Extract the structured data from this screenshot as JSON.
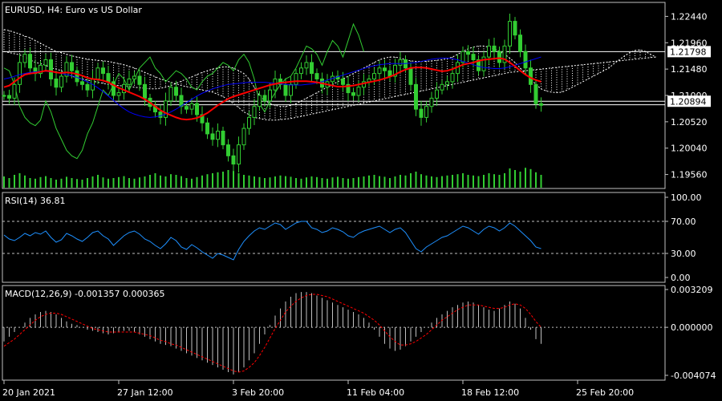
{
  "chart_data": [
    {
      "type": "candlestick",
      "title": "EURUSD, H4:  Euro vs US Dollar",
      "ylim": [
        1.1932,
        1.2268
      ],
      "y_ticks": [
        "1.22440",
        "1.21960",
        "1.21480",
        "1.21000",
        "1.20520",
        "1.20040",
        "1.19560"
      ],
      "price_labels": [
        {
          "value": 1.21798,
          "text": "1.21798"
        },
        {
          "value": 1.20894,
          "text": "1.20894"
        }
      ],
      "hlines": [
        1.21798,
        1.20894,
        1.2083
      ],
      "grid": false,
      "colors": {
        "candle": "#32cd32",
        "ma_fast": "#ff0000",
        "ma_slow": "#0000ff",
        "lagging": "#32cd32",
        "cloud": "#ffffff",
        "volume": "#32cd32"
      },
      "close": [
        1.21,
        1.2095,
        1.212,
        1.216,
        1.2175,
        1.215,
        1.214,
        1.2155,
        1.2165,
        1.213,
        1.2115,
        1.2135,
        1.216,
        1.2145,
        1.2125,
        1.212,
        1.211,
        1.213,
        1.215,
        1.214,
        1.2125,
        1.21,
        1.2105,
        1.212,
        1.213,
        1.2135,
        1.212,
        1.2095,
        1.208,
        1.207,
        1.206,
        1.209,
        1.2115,
        1.21,
        1.208,
        1.2075,
        1.2085,
        1.2065,
        1.205,
        1.203,
        1.202,
        1.2035,
        1.201,
        1.199,
        1.1975,
        1.201,
        1.204,
        1.206,
        1.208,
        1.21,
        1.209,
        1.211,
        1.213,
        1.212,
        1.21,
        1.212,
        1.214,
        1.215,
        1.216,
        1.214,
        1.213,
        1.2115,
        1.2125,
        1.2135,
        1.213,
        1.212,
        1.2105,
        1.21,
        1.2115,
        1.2125,
        1.213,
        1.214,
        1.215,
        1.2145,
        1.2135,
        1.2155,
        1.2165,
        1.215,
        1.212,
        1.2075,
        1.206,
        1.208,
        1.2095,
        1.211,
        1.212,
        1.2125,
        1.214,
        1.216,
        1.218,
        1.2175,
        1.2165,
        1.2145,
        1.217,
        1.219,
        1.218,
        1.216,
        1.219,
        1.2235,
        1.221,
        1.218,
        1.215,
        1.212,
        1.2085,
        1.2082
      ],
      "ma_fast": [
        1.2115,
        1.2118,
        1.2125,
        1.2132,
        1.2138,
        1.214,
        1.2141,
        1.2143,
        1.2145,
        1.2144,
        1.2142,
        1.2141,
        1.2142,
        1.2141,
        1.2139,
        1.2136,
        1.2132,
        1.213,
        1.2129,
        1.2127,
        1.2124,
        1.2119,
        1.2114,
        1.211,
        1.2106,
        1.2102,
        1.2098,
        1.2093,
        1.2087,
        1.208,
        1.2073,
        1.2068,
        1.2064,
        1.206,
        1.2057,
        1.2056,
        1.2057,
        1.2059,
        1.2063,
        1.2068,
        1.2075,
        1.2082,
        1.2088,
        1.2094,
        1.2098,
        1.2101,
        1.2104,
        1.2107,
        1.211,
        1.2113,
        1.2116,
        1.2119,
        1.2121,
        1.2123,
        1.2124,
        1.2125,
        1.2126,
        1.2126,
        1.2126,
        1.2125,
        1.2124,
        1.2122,
        1.212,
        1.2118,
        1.2116,
        1.2116,
        1.2117,
        1.2118,
        1.212,
        1.2122,
        1.2124,
        1.2126,
        1.2128,
        1.2131,
        1.2134,
        1.2138,
        1.2143,
        1.2147,
        1.215,
        1.2151,
        1.2151,
        1.215,
        1.2148,
        1.2146,
        1.2144,
        1.2145,
        1.2148,
        1.2152,
        1.2156,
        1.2158,
        1.216,
        1.2163,
        1.2165,
        1.2166,
        1.2167,
        1.2168,
        1.2166,
        1.216,
        1.2153,
        1.2145,
        1.2138,
        1.2132,
        1.2128,
        1.2125
      ],
      "ma_slow": [
        1.213,
        1.2132,
        1.2135,
        1.2138,
        1.214,
        1.2142,
        1.2143,
        1.2144,
        1.2144,
        1.2143,
        1.2142,
        1.214,
        1.2138,
        1.2136,
        1.2133,
        1.2129,
        1.2125,
        1.212,
        1.2114,
        1.2107,
        1.2099,
        1.2091,
        1.2083,
        1.2076,
        1.207,
        1.2066,
        1.2063,
        1.2061,
        1.206,
        1.2061,
        1.2063,
        1.2066,
        1.207,
        1.2075,
        1.2081,
        1.2087,
        1.2093,
        1.2099,
        1.2104,
        1.2108,
        1.2112,
        1.2115,
        1.2118,
        1.212,
        1.2121,
        1.2122,
        1.2123,
        1.2124,
        1.2124,
        1.2124,
        1.2124,
        1.2123,
        1.2122,
        1.2121,
        1.212,
        1.2119,
        1.2119,
        1.2119,
        1.212,
        1.2121,
        1.2123,
        1.2125,
        1.2128,
        1.2131,
        1.2134,
        1.2137,
        1.214,
        1.2143,
        1.2146,
        1.2149,
        1.2152,
        1.2154,
        1.2156,
        1.2157,
        1.2158,
        1.2158,
        1.2158,
        1.2158,
        1.2159,
        1.216,
        1.2162,
        1.2164,
        1.2166,
        1.2167,
        1.2168,
        1.2168,
        1.2167,
        1.2165,
        1.2162,
        1.2159,
        1.2156,
        1.2153,
        1.2151,
        1.215,
        1.2149,
        1.2149,
        1.215,
        1.2152,
        1.2155,
        1.2158,
        1.2161,
        1.2164,
        1.2167,
        1.217
      ],
      "lagging": [
        1.215,
        1.2145,
        1.212,
        1.208,
        1.206,
        1.205,
        1.2045,
        1.2055,
        1.209,
        1.207,
        1.204,
        1.202,
        1.2,
        1.199,
        1.1985,
        1.2,
        1.203,
        1.205,
        1.208,
        1.211,
        1.21,
        1.212,
        1.214,
        1.213,
        1.211,
        1.213,
        1.215,
        1.216,
        1.217,
        1.215,
        1.214,
        1.2125,
        1.2135,
        1.2145,
        1.214,
        1.213,
        1.2115,
        1.211,
        1.2125,
        1.2135,
        1.214,
        1.215,
        1.216,
        1.2155,
        1.2145,
        1.2165,
        1.2175,
        1.216,
        1.213,
        1.2085,
        1.207,
        1.209,
        1.2105,
        1.212,
        1.213,
        1.2135,
        1.215,
        1.217,
        1.219,
        1.2185,
        1.2175,
        1.2155,
        1.218,
        1.22,
        1.219,
        1.217,
        1.22,
        1.223,
        1.221,
        1.218
      ],
      "cloud_a": [
        1.218,
        1.2178,
        1.2176,
        1.2174,
        1.217,
        1.2165,
        1.216,
        1.2158,
        1.2155,
        1.215,
        1.2148,
        1.2145,
        1.214,
        1.2135,
        1.2132,
        1.213,
        1.2128,
        1.2126,
        1.2124,
        1.2122,
        1.212,
        1.2119,
        1.2118,
        1.2117,
        1.2116,
        1.2115,
        1.2114,
        1.2113,
        1.2112,
        1.2112,
        1.2113,
        1.2115,
        1.2118,
        1.2122,
        1.2126,
        1.213,
        1.2134,
        1.2138,
        1.2142,
        1.2145,
        1.2148,
        1.215,
        1.2152,
        1.2152,
        1.215,
        1.2145,
        1.214,
        1.213,
        1.2115,
        1.21,
        1.209,
        1.2085,
        1.2082,
        1.208,
        1.208,
        1.2082,
        1.2085,
        1.209,
        1.2095,
        1.21,
        1.2105,
        1.211,
        1.2115,
        1.212,
        1.2125,
        1.213,
        1.2135,
        1.214,
        1.2145,
        1.215,
        1.2155,
        1.216,
        1.2165,
        1.2168,
        1.217,
        1.217,
        1.2168,
        1.2165,
        1.2163,
        1.2162,
        1.2162,
        1.2162,
        1.2163,
        1.2164,
        1.2165,
        1.2167,
        1.217,
        1.2175,
        1.218,
        1.2185,
        1.2188,
        1.219,
        1.219,
        1.2188,
        1.2185,
        1.218,
        1.2175,
        1.2168,
        1.216,
        1.215,
        1.214,
        1.213,
        1.212,
        1.2112,
        1.2108,
        1.2106,
        1.2105,
        1.2106,
        1.211,
        1.2115,
        1.212,
        1.2125,
        1.213,
        1.2135,
        1.214,
        1.2145,
        1.215,
        1.2158,
        1.2165,
        1.2172,
        1.2178,
        1.2182,
        1.2183,
        1.218,
        1.2175,
        1.217
      ],
      "cloud_b": [
        1.222,
        1.2218,
        1.2215,
        1.2212,
        1.2208,
        1.2205,
        1.22,
        1.2195,
        1.219,
        1.2185,
        1.218,
        1.2178,
        1.2175,
        1.2172,
        1.217,
        1.2168,
        1.2166,
        1.2165,
        1.2164,
        1.2163,
        1.2162,
        1.216,
        1.2158,
        1.2156,
        1.2153,
        1.215,
        1.2146,
        1.2142,
        1.2138,
        1.2134,
        1.213,
        1.2127,
        1.2124,
        1.2121,
        1.2118,
        1.2116,
        1.2114,
        1.2112,
        1.211,
        1.2108,
        1.2106,
        1.2102,
        1.2098,
        1.2092,
        1.2085,
        1.2078,
        1.207,
        1.2065,
        1.206,
        1.2058,
        1.2056,
        1.2055,
        1.2055,
        1.2056,
        1.2057,
        1.2058,
        1.206,
        1.2062,
        1.2064,
        1.2066,
        1.2068,
        1.207,
        1.2072,
        1.2074,
        1.2076,
        1.2078,
        1.208,
        1.2082,
        1.2084,
        1.2086,
        1.2088,
        1.209,
        1.2092,
        1.2094,
        1.2096,
        1.2098,
        1.21,
        1.2102,
        1.2104,
        1.2106,
        1.2108,
        1.211,
        1.2112,
        1.2114,
        1.2116,
        1.2118,
        1.212,
        1.2122,
        1.2124,
        1.2126,
        1.2128,
        1.213,
        1.2132,
        1.2134,
        1.2136,
        1.2138,
        1.214,
        1.2142,
        1.2143,
        1.2144,
        1.2145,
        1.2146,
        1.2147,
        1.2148,
        1.2149,
        1.215,
        1.2151,
        1.2152,
        1.2153,
        1.2154,
        1.2155,
        1.2156,
        1.2157,
        1.2158,
        1.2159,
        1.216,
        1.2161,
        1.2162,
        1.2163,
        1.2164,
        1.2165,
        1.2166,
        1.2167,
        1.2168,
        1.2169,
        1.217
      ],
      "volume": [
        0.35,
        0.3,
        0.4,
        0.45,
        0.38,
        0.3,
        0.28,
        0.33,
        0.36,
        0.3,
        0.25,
        0.28,
        0.34,
        0.3,
        0.27,
        0.25,
        0.3,
        0.35,
        0.4,
        0.32,
        0.28,
        0.3,
        0.33,
        0.36,
        0.3,
        0.28,
        0.32,
        0.35,
        0.4,
        0.45,
        0.38,
        0.35,
        0.42,
        0.4,
        0.36,
        0.3,
        0.28,
        0.33,
        0.38,
        0.42,
        0.45,
        0.48,
        0.5,
        0.55,
        0.52,
        0.45,
        0.4,
        0.38,
        0.35,
        0.33,
        0.3,
        0.32,
        0.35,
        0.38,
        0.36,
        0.34,
        0.3,
        0.28,
        0.32,
        0.35,
        0.33,
        0.3,
        0.28,
        0.32,
        0.34,
        0.3,
        0.28,
        0.3,
        0.33,
        0.35,
        0.38,
        0.4,
        0.36,
        0.34,
        0.3,
        0.35,
        0.4,
        0.38,
        0.45,
        0.5,
        0.42,
        0.38,
        0.35,
        0.33,
        0.36,
        0.38,
        0.4,
        0.42,
        0.45,
        0.4,
        0.38,
        0.36,
        0.4,
        0.45,
        0.42,
        0.4,
        0.45,
        0.6,
        0.55,
        0.5,
        0.62,
        0.58,
        0.48,
        0.4
      ]
    },
    {
      "type": "line",
      "title": "RSI(14) 36.81",
      "ylim": [
        0,
        100
      ],
      "y_ticks": [
        "100.00",
        "70.00",
        "30.00",
        "0.00"
      ],
      "levels": [
        70,
        30
      ],
      "colors": {
        "line": "#1e90ff",
        "level": "#c0c0c0"
      },
      "values": [
        53,
        48,
        46,
        50,
        55,
        52,
        56,
        54,
        58,
        50,
        44,
        47,
        55,
        52,
        48,
        45,
        50,
        56,
        58,
        52,
        48,
        40,
        46,
        52,
        56,
        58,
        54,
        48,
        45,
        40,
        36,
        42,
        50,
        46,
        38,
        35,
        41,
        37,
        32,
        28,
        24,
        30,
        28,
        25,
        22,
        35,
        45,
        52,
        58,
        62,
        60,
        64,
        68,
        66,
        60,
        64,
        68,
        70,
        70,
        62,
        60,
        56,
        58,
        62,
        60,
        57,
        52,
        50,
        55,
        58,
        60,
        62,
        64,
        60,
        56,
        60,
        62,
        56,
        46,
        36,
        32,
        38,
        42,
        46,
        50,
        52,
        56,
        60,
        64,
        62,
        58,
        54,
        60,
        64,
        62,
        58,
        62,
        68,
        64,
        58,
        52,
        46,
        38,
        36
      ]
    },
    {
      "type": "bar",
      "title": "MACD(12,26,9) -0.001357 0.000365",
      "ylim": [
        -0.004074,
        0.003209
      ],
      "y_ticks": [
        "0.003209",
        "0.000000",
        "-0.004074"
      ],
      "colors": {
        "bar": "#c0c0c0",
        "signal": "#ff0000",
        "zero": "#c0c0c0"
      },
      "values": [
        -0.0012,
        -0.0008,
        -0.0004,
        0.0,
        0.0004,
        0.0008,
        0.0011,
        0.0013,
        0.0014,
        0.0013,
        0.0011,
        0.0008,
        0.0005,
        0.0003,
        0.0002,
        0.0,
        -0.0002,
        -0.0003,
        -0.0004,
        -0.0005,
        -0.0006,
        -0.0005,
        -0.0004,
        -0.0003,
        -0.0003,
        -0.0004,
        -0.0006,
        -0.0008,
        -0.001,
        -0.0012,
        -0.0014,
        -0.0015,
        -0.0016,
        -0.0018,
        -0.002,
        -0.0022,
        -0.0024,
        -0.0026,
        -0.0028,
        -0.003,
        -0.0032,
        -0.0034,
        -0.0036,
        -0.0038,
        -0.004,
        -0.0038,
        -0.0034,
        -0.0028,
        -0.0022,
        -0.0014,
        -0.0006,
        0.0002,
        0.001,
        0.0016,
        0.0022,
        0.0026,
        0.0029,
        0.003,
        0.003,
        0.0029,
        0.0027,
        0.0025,
        0.0023,
        0.0021,
        0.0019,
        0.0017,
        0.0015,
        0.0013,
        0.0011,
        0.0008,
        0.0004,
        -0.0002,
        -0.0008,
        -0.0014,
        -0.0018,
        -0.002,
        -0.0019,
        -0.0016,
        -0.0012,
        -0.0008,
        -0.0004,
        0.0,
        0.0004,
        0.0008,
        0.0011,
        0.0014,
        0.0017,
        0.0019,
        0.0021,
        0.0022,
        0.0021,
        0.0019,
        0.0017,
        0.0015,
        0.0014,
        0.0016,
        0.0019,
        0.0022,
        0.002,
        0.0016,
        0.0008,
        -0.0002,
        -0.001,
        -0.0014
      ],
      "signal": [
        -0.0016,
        -0.0013,
        -0.001,
        -0.0006,
        -0.0002,
        0.0002,
        0.0006,
        0.0009,
        0.0011,
        0.0012,
        0.0012,
        0.0011,
        0.0009,
        0.0007,
        0.0005,
        0.0003,
        0.0001,
        -0.0001,
        -0.0002,
        -0.0003,
        -0.0004,
        -0.0004,
        -0.0004,
        -0.0004,
        -0.0004,
        -0.0004,
        -0.0005,
        -0.0006,
        -0.0007,
        -0.0009,
        -0.0011,
        -0.0012,
        -0.0014,
        -0.0015,
        -0.0017,
        -0.0019,
        -0.0021,
        -0.0023,
        -0.0025,
        -0.0027,
        -0.0029,
        -0.0031,
        -0.0033,
        -0.0035,
        -0.0037,
        -0.0038,
        -0.0037,
        -0.0034,
        -0.003,
        -0.0024,
        -0.0017,
        -0.0009,
        -0.0001,
        0.0006,
        0.0013,
        0.0018,
        0.0022,
        0.0025,
        0.0027,
        0.0028,
        0.0028,
        0.0027,
        0.0026,
        0.0024,
        0.0022,
        0.002,
        0.0018,
        0.0016,
        0.0014,
        0.0012,
        0.0009,
        0.0006,
        0.0002,
        -0.0003,
        -0.0008,
        -0.0012,
        -0.0015,
        -0.0015,
        -0.0014,
        -0.0012,
        -0.0009,
        -0.0006,
        -0.0002,
        0.0002,
        0.0006,
        0.0009,
        0.0012,
        0.0015,
        0.0017,
        0.0019,
        0.0019,
        0.0019,
        0.0018,
        0.0017,
        0.0016,
        0.0016,
        0.0017,
        0.0019,
        0.002,
        0.0019,
        0.0016,
        0.0011,
        0.0005,
        0.0
      ]
    }
  ],
  "x_axis": {
    "labels": [
      "20 Jan 2021",
      "27 Jan 12:00",
      "3 Feb 20:00",
      "11 Feb 04:00",
      "18 Feb 12:00",
      "25 Feb 20:00"
    ],
    "label_bar_index": [
      0,
      22,
      44,
      66,
      88,
      110
    ]
  }
}
